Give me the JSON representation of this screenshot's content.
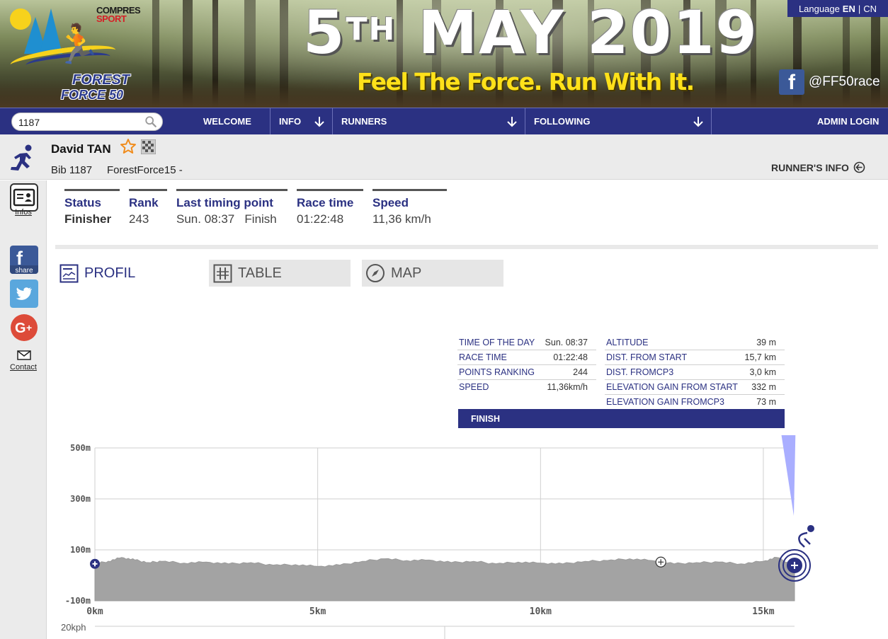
{
  "banner": {
    "sponsor_line1": "COMPRES",
    "sponsor_line2": "SPORT",
    "logo_line1": "FOREST",
    "logo_line2": "FORCE 50",
    "date_day": "5",
    "date_suffix": "TH",
    "date_rest": "MAY 2019",
    "tagline": "Feel The Force. Run With It.",
    "facebook_handle": "@FF50race"
  },
  "language": {
    "label": "Language",
    "en": "EN",
    "sep": "|",
    "cn": "CN"
  },
  "nav": {
    "search_value": "1187",
    "welcome": "WELCOME",
    "info": "INFO",
    "runners": "RUNNERS",
    "following": "FOLLOWING",
    "admin_login": "ADMIN LOGIN"
  },
  "runner": {
    "name": "David TAN",
    "bib": "Bib 1187",
    "race": "ForestForce15 -",
    "runners_info_label": "RUNNER'S INFO"
  },
  "sidebar": {
    "infos_label": "Infos",
    "fb_share": "share",
    "contact_label": "Contact"
  },
  "stats": [
    {
      "label": "Status",
      "value": "Finisher",
      "value_bold": true
    },
    {
      "label": "Rank",
      "value": "243"
    },
    {
      "label": "Last timing point",
      "value": "Sun. 08:37   Finish"
    },
    {
      "label": "Race time",
      "value": "01:22:48"
    },
    {
      "label": "Speed",
      "value": "11,36 km/h"
    }
  ],
  "tabs": {
    "profil": "PROFIL",
    "table": "TABLE",
    "map": "MAP"
  },
  "info_panel": {
    "left": [
      {
        "k": "TIME OF THE DAY",
        "v": "Sun. 08:37"
      },
      {
        "k": "RACE TIME",
        "v": "01:22:48"
      },
      {
        "k": "POINTS RANKING",
        "v": "244"
      },
      {
        "k": "SPEED",
        "v": "11,36km/h"
      }
    ],
    "right": [
      {
        "k": "ALTITUDE",
        "v": "39 m"
      },
      {
        "k": "DIST. FROM START",
        "v": "15,7 km"
      },
      {
        "k": "DIST. FROMCP3",
        "v": "3,0 km"
      },
      {
        "k": "ELEVATION GAIN FROM START",
        "v": "332 m"
      },
      {
        "k": "ELEVATION GAIN FROMCP3",
        "v": "73 m"
      }
    ],
    "point_label": "FINISH"
  },
  "colors": {
    "brand_blue": "#2b3182",
    "profile_fill": "#a3a3a3",
    "tab_inactive_bg": "#e6e6e6",
    "marker_pointer": "#a9aeff"
  },
  "chart_data": {
    "type": "area",
    "title": "",
    "xlabel": "",
    "ylabel": "",
    "y_tick_labels": [
      "500m",
      "300m",
      "100m",
      "-100m"
    ],
    "y_ticks": [
      500,
      300,
      100,
      -100
    ],
    "x_tick_labels": [
      "0km",
      "5km",
      "10km",
      "15km"
    ],
    "x_ticks": [
      0,
      5,
      10,
      15
    ],
    "xlim": [
      0,
      15.7
    ],
    "ylim": [
      -100,
      500
    ],
    "speed_axis_label": "20kph",
    "grid": true,
    "x": [
      0,
      0.3,
      0.6,
      0.9,
      1.2,
      1.5,
      2.0,
      2.5,
      3.0,
      3.5,
      4.0,
      4.5,
      5.0,
      5.5,
      6.0,
      6.5,
      7.0,
      7.5,
      8.0,
      8.5,
      9.0,
      9.5,
      10.0,
      10.5,
      11.0,
      11.5,
      12.0,
      12.5,
      13.0,
      13.5,
      14.0,
      14.5,
      15.0,
      15.3,
      15.7
    ],
    "y": [
      45,
      55,
      70,
      60,
      50,
      55,
      48,
      52,
      45,
      50,
      40,
      42,
      35,
      40,
      55,
      65,
      58,
      60,
      50,
      55,
      45,
      52,
      48,
      45,
      55,
      58,
      65,
      58,
      45,
      50,
      52,
      45,
      55,
      70,
      39
    ],
    "markers": [
      {
        "name": "start",
        "x": 0,
        "y": 45
      },
      {
        "name": "checkpoint",
        "x": 12.7,
        "y": 52
      },
      {
        "name": "finish",
        "x": 15.7,
        "y": 39
      }
    ]
  }
}
